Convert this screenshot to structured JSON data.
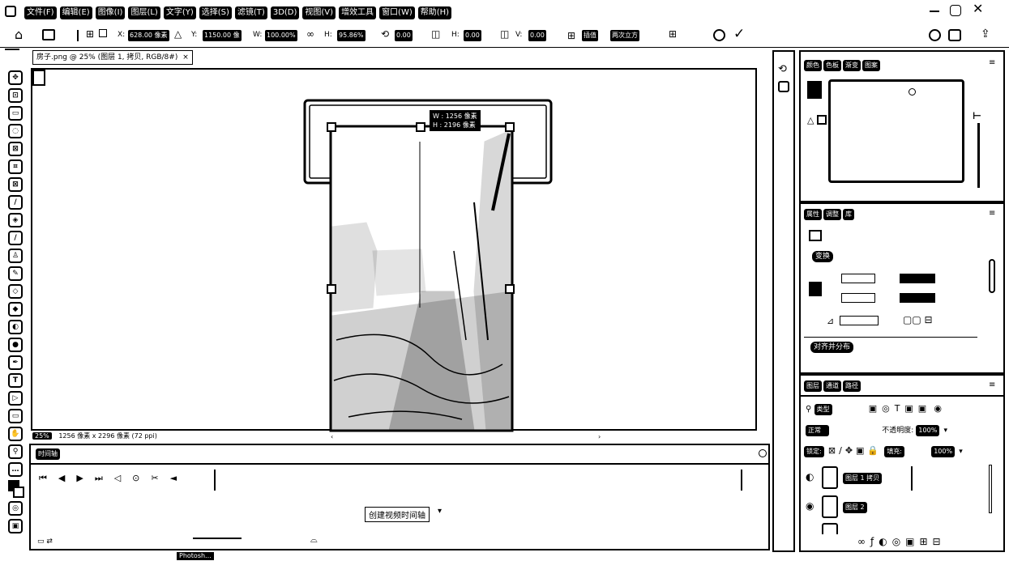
{
  "menubar": {
    "items": [
      "文件(F)",
      "编辑(E)",
      "图像(I)",
      "图层(L)",
      "文字(Y)",
      "选择(S)",
      "滤镜(T)",
      "3D(D)",
      "视图(V)",
      "增效工具",
      "窗口(W)",
      "帮助(H)"
    ]
  },
  "options": {
    "x_label": "X:",
    "x_value": "628.00 像素",
    "y_value": "1150.00 像",
    "w_label": "W:",
    "w_value": "100.00%",
    "h_value": "95.86%",
    "angle_value": "0.00",
    "h_skew": "0.00",
    "v_label": "V:",
    "v_skew": "0.00",
    "interp": "插值",
    "interp_mode": "两次立方"
  },
  "document": {
    "tab_title": "房子.png @ 25% (图层 1, 拷贝, RGB/8#)",
    "status_zoom": "25%",
    "status_info": "1256 像素 x 2296 像素 (72 ppi)",
    "transform_tooltip": [
      "W : 1256 像素",
      "H : 2196 像素"
    ]
  },
  "timeline": {
    "title": "时间轴",
    "create_button": "创建视频时间轴"
  },
  "navigator": {
    "tabs": [
      "颜色",
      "色板",
      "渐变",
      "图案"
    ]
  },
  "properties": {
    "tabs": [
      "属性",
      "调整",
      "库"
    ],
    "section_transform": "变换",
    "section_align": "对齐并分布"
  },
  "layers": {
    "tabs": [
      "图层",
      "通道",
      "路径"
    ],
    "kind_label": "类型",
    "blend_mode": "正常",
    "opacity_label": "不透明度:",
    "opacity_value": "100%",
    "lock_label": "锁定:",
    "fill_label": "填充:",
    "fill_value": "100%",
    "rows": [
      {
        "name": "图层 1 拷贝"
      },
      {
        "name": "图层 2"
      },
      {
        "name": ""
      }
    ]
  },
  "taskbar": {
    "app_label": "Photosh..."
  }
}
